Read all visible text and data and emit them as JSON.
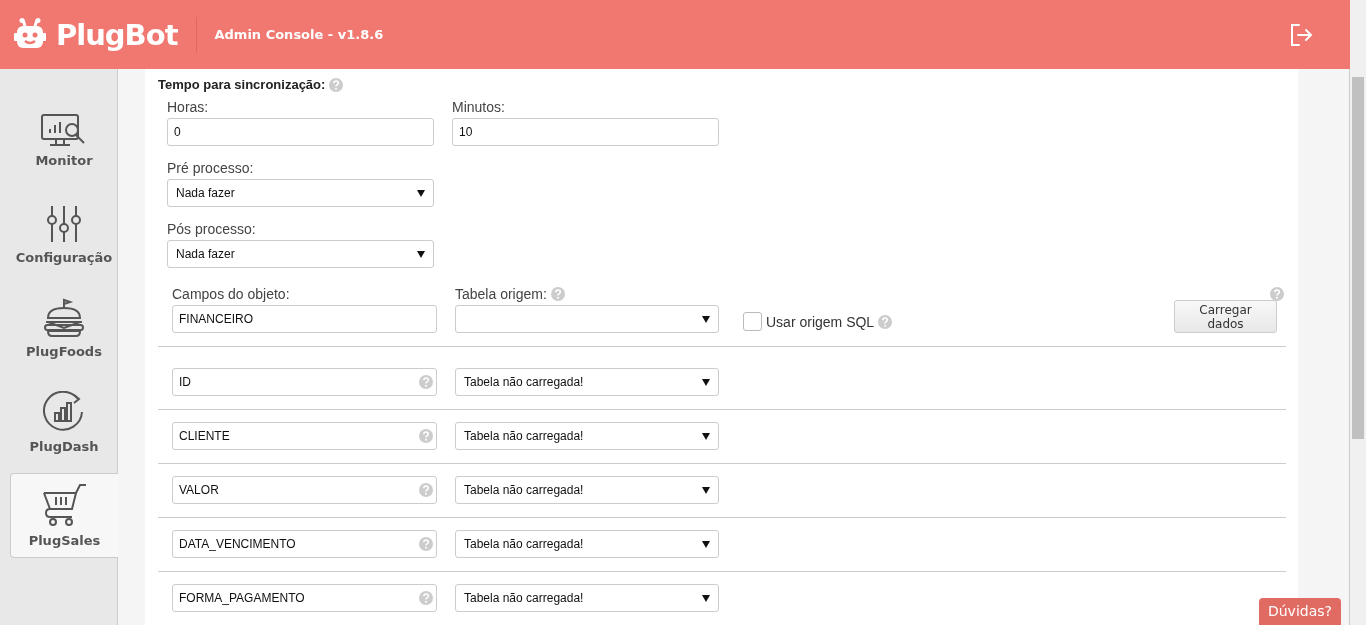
{
  "header": {
    "logo": "PlugBot",
    "title": "Admin Console - v1.8.6"
  },
  "sidebar": {
    "items": [
      {
        "label": "Monitor",
        "kind": "monitor",
        "selected": false
      },
      {
        "label": "Configuração",
        "kind": "sliders",
        "selected": false
      },
      {
        "label": "PlugFoods",
        "kind": "burger",
        "selected": false
      },
      {
        "label": "PlugDash",
        "kind": "dash",
        "selected": false
      },
      {
        "label": "PlugSales",
        "kind": "cart",
        "selected": true
      }
    ]
  },
  "sync": {
    "title": "Tempo para sincronização:",
    "hours": {
      "label": "Horas:",
      "value": "0"
    },
    "minutes": {
      "label": "Minutos:",
      "value": "10"
    }
  },
  "pre_process": {
    "label": "Pré processo:",
    "value": "Nada fazer"
  },
  "post_process": {
    "label": "Pós processo:",
    "value": "Nada fazer"
  },
  "object_fields": {
    "label": "Campos do objeto:",
    "value": "FINANCEIRO"
  },
  "source_table": {
    "label": "Tabela origem:"
  },
  "use_sql": {
    "label": "Usar origem SQL",
    "checked": false
  },
  "load_button": "Carregar dados",
  "fields": [
    {
      "name": "ID",
      "mapping": "Tabela não carregada!"
    },
    {
      "name": "CLIENTE",
      "mapping": "Tabela não carregada!"
    },
    {
      "name": "VALOR",
      "mapping": "Tabela não carregada!"
    },
    {
      "name": "DATA_VENCIMENTO",
      "mapping": "Tabela não carregada!"
    },
    {
      "name": "FORMA_PAGAMENTO",
      "mapping": "Tabela não carregada!"
    }
  ],
  "help_button": "Dúvidas?"
}
